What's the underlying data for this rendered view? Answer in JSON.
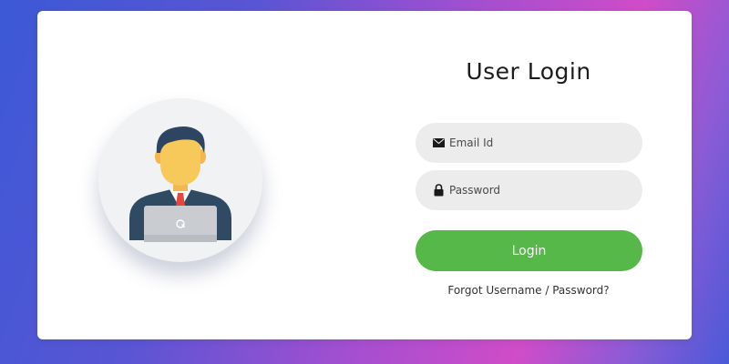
{
  "login": {
    "title": "User Login",
    "email_placeholder": "Email Id",
    "password_placeholder": "Password",
    "submit_label": "Login",
    "forgot_link": "Forgot Username / Password?"
  },
  "icons": {
    "avatar": "user-at-laptop-icon",
    "email": "envelope-icon",
    "password": "lock-icon"
  },
  "colors": {
    "button": "#57b84a",
    "field_bg": "#ececec",
    "card_bg": "#ffffff"
  }
}
